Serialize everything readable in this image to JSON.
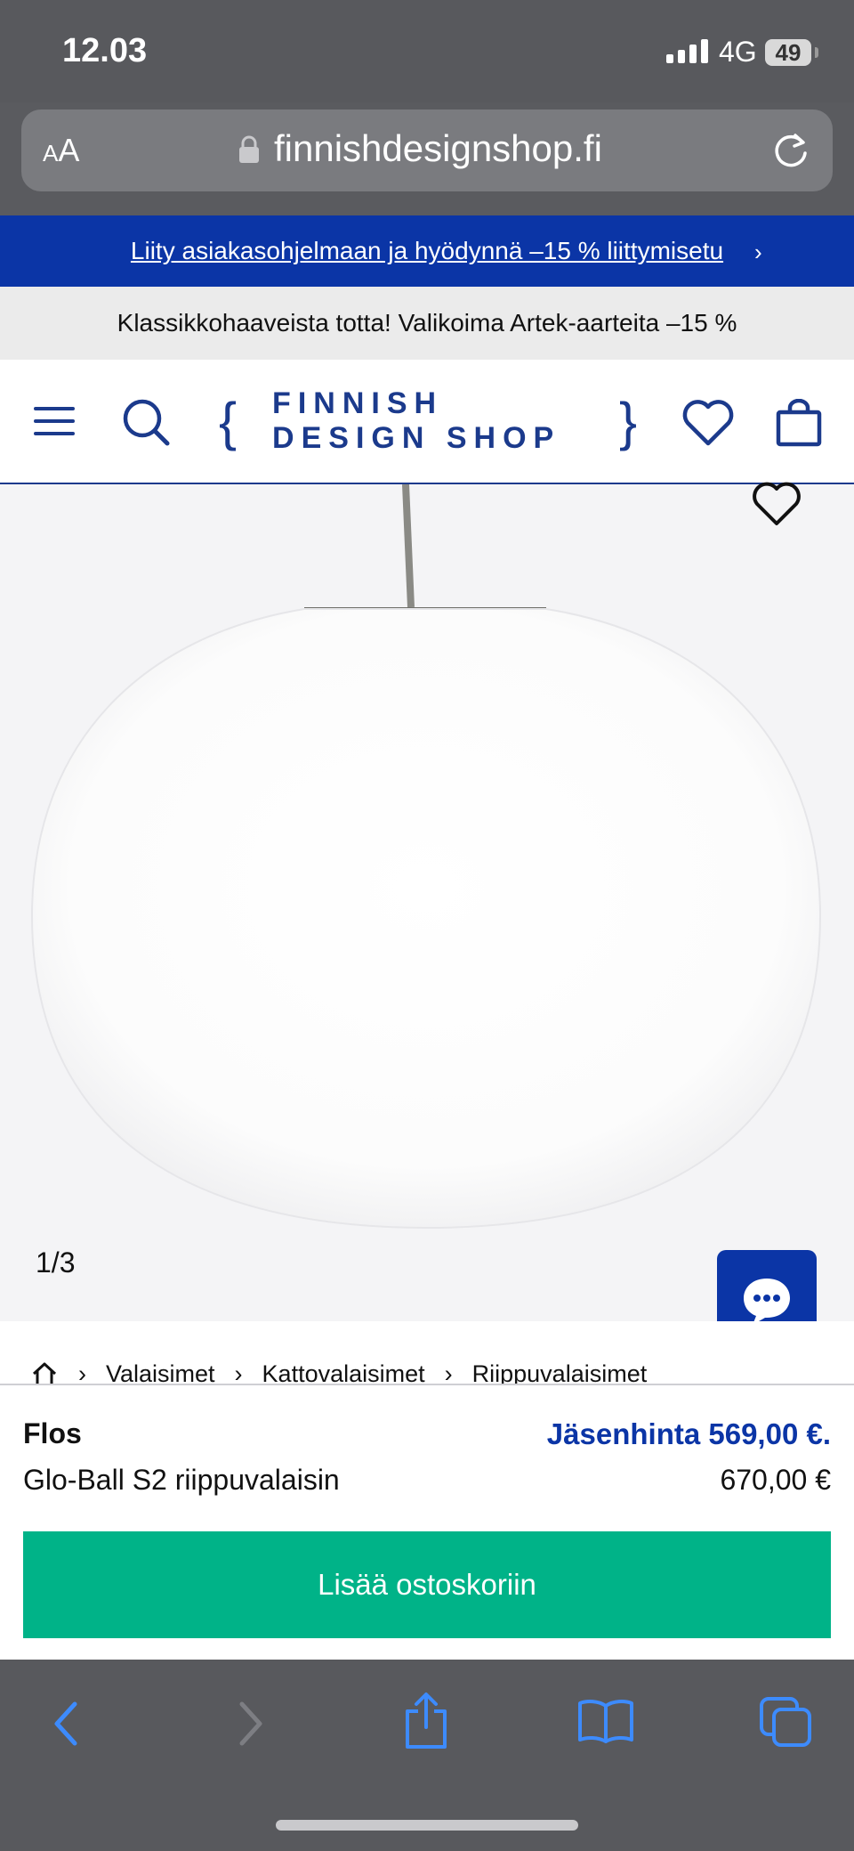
{
  "status": {
    "time": "12.03",
    "network": "4G",
    "battery": "49"
  },
  "browser": {
    "text_size_label_small": "A",
    "text_size_label_large": "A",
    "url": "finnishdesignshop.fi"
  },
  "promos": {
    "membership": "Liity asiakasohjelmaan ja hyödynnä –15 % liittymisetu",
    "membership_arrow": "›",
    "artek": "Klassikkohaaveista totta! Valikoima Artek-aarteita –15 %"
  },
  "header": {
    "logo_text": "FINNISH DESIGN SHOP",
    "brace_left": "{",
    "brace_right": "}"
  },
  "gallery": {
    "counter": "1/3"
  },
  "breadcrumb": {
    "items": [
      "Valaisimet",
      "Kattovalaisimet",
      "Riippuvalaisimet"
    ],
    "separator": "›"
  },
  "product": {
    "brand": "Flos",
    "name": "Glo-Ball S2 riippuvalaisin",
    "member_price": "Jäsenhinta 569,00 €.",
    "price": "670,00 €",
    "add_to_cart": "Lisää ostoskoriin"
  },
  "colors": {
    "brand_blue": "#0b35a6",
    "cart_green": "#00b388",
    "chrome_gray": "#58595d"
  },
  "icons": {
    "menu": "hamburger-icon",
    "search": "search-icon",
    "wishlist": "heart-icon",
    "cart": "bag-icon",
    "chat": "chat-icon",
    "home": "home-icon"
  }
}
